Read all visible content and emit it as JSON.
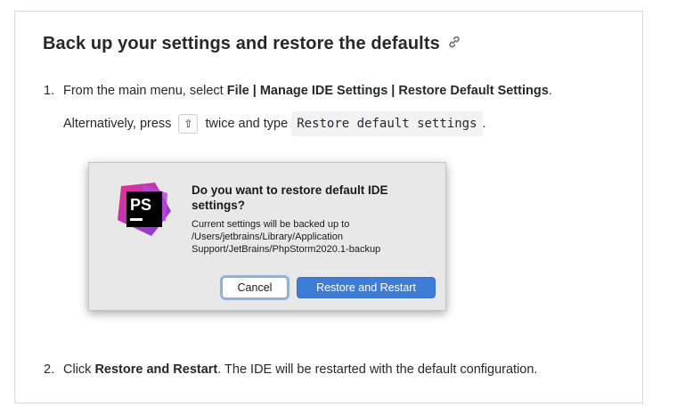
{
  "heading": "Back up your settings and restore the defaults",
  "step1": {
    "number": "1.",
    "prefix": "From the main menu, select ",
    "menu_path": "File | Manage IDE Settings | Restore Default Settings",
    "suffix": "."
  },
  "alternative": {
    "prefix": "Alternatively, press",
    "key": "⇧",
    "middle": "twice and type",
    "code": "Restore default settings",
    "suffix": "."
  },
  "dialog": {
    "logo_text": "PS",
    "title": "Do you want to restore default IDE settings?",
    "message": "Current settings will be backed up to /Users/jetbrains/Library/Application Support/JetBrains/PhpStorm2020.1-backup",
    "cancel_label": "Cancel",
    "restore_label": "Restore and Restart"
  },
  "step2": {
    "number": "2.",
    "prefix": "Click ",
    "action": "Restore and Restart",
    "suffix": ". The IDE will be restarted with the default configuration."
  },
  "colors": {
    "accent": "#3d7dd8",
    "logo_pink": "#e9308f",
    "logo_purple": "#7b3fe4"
  }
}
